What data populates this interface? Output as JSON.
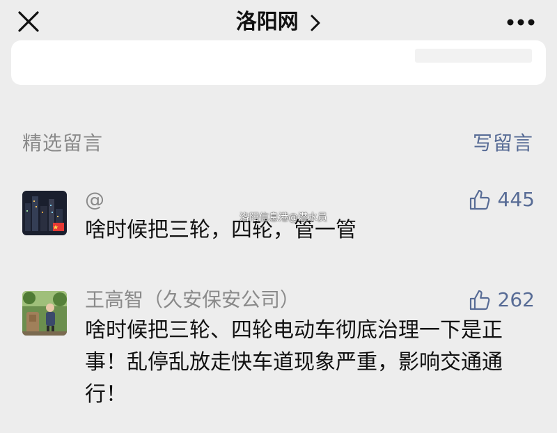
{
  "header": {
    "title": "洛阳网",
    "close_icon": "close-icon",
    "chevron_icon": "chevron-right-icon",
    "more_icon": "more-icon"
  },
  "section": {
    "title": "精选留言",
    "write_label": "写留言"
  },
  "comments": [
    {
      "name": "@",
      "likes": "445",
      "text": "啥时候把三轮，四轮，管一管"
    },
    {
      "name": "王高智（久安保安公司）",
      "likes": "262",
      "text": "啥时候把三轮、四轮电动车彻底治理一下是正事！乱停乱放走快车道现象严重，影响交通通行！"
    }
  ],
  "watermark": "洛阳信息港@潜水员",
  "colors": {
    "background": "#ededed",
    "link": "#576b95",
    "muted": "#8a8a8a",
    "card": "#ffffff"
  }
}
